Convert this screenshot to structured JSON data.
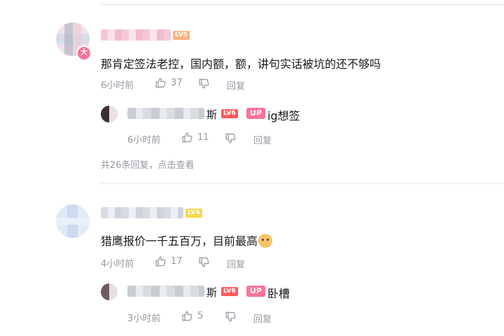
{
  "colors": {
    "accent": "#fb7299",
    "lv5": "#ffb27f",
    "lv6": "#ff5b5b",
    "lv4": "#f5d84c",
    "muted": "#9499a0",
    "text": "#18191c"
  },
  "comments": [
    {
      "level": "LV5",
      "content": "那肯定签法老控，国内额，额，讲句实话被坑的还不够吗",
      "time": "6小时前",
      "likes": "37",
      "reply_label": "回复",
      "reply": {
        "name_visible_fragment": "斯",
        "level": "LV6",
        "up_badge": "UP",
        "content": "ig想签",
        "time": "6小时前",
        "likes": "11",
        "reply_label": "回复"
      },
      "more_replies": "共26条回复，点击查看"
    },
    {
      "level": "LV4",
      "content": "猎鹰报价一千五百万，目前最高",
      "time": "4小时前",
      "likes": "17",
      "reply_label": "回复",
      "reply": {
        "name_visible_fragment": "斯",
        "level": "LV6",
        "up_badge": "UP",
        "content": "卧槽",
        "time": "3小时前",
        "likes": "5",
        "reply_label": "回复"
      }
    }
  ]
}
